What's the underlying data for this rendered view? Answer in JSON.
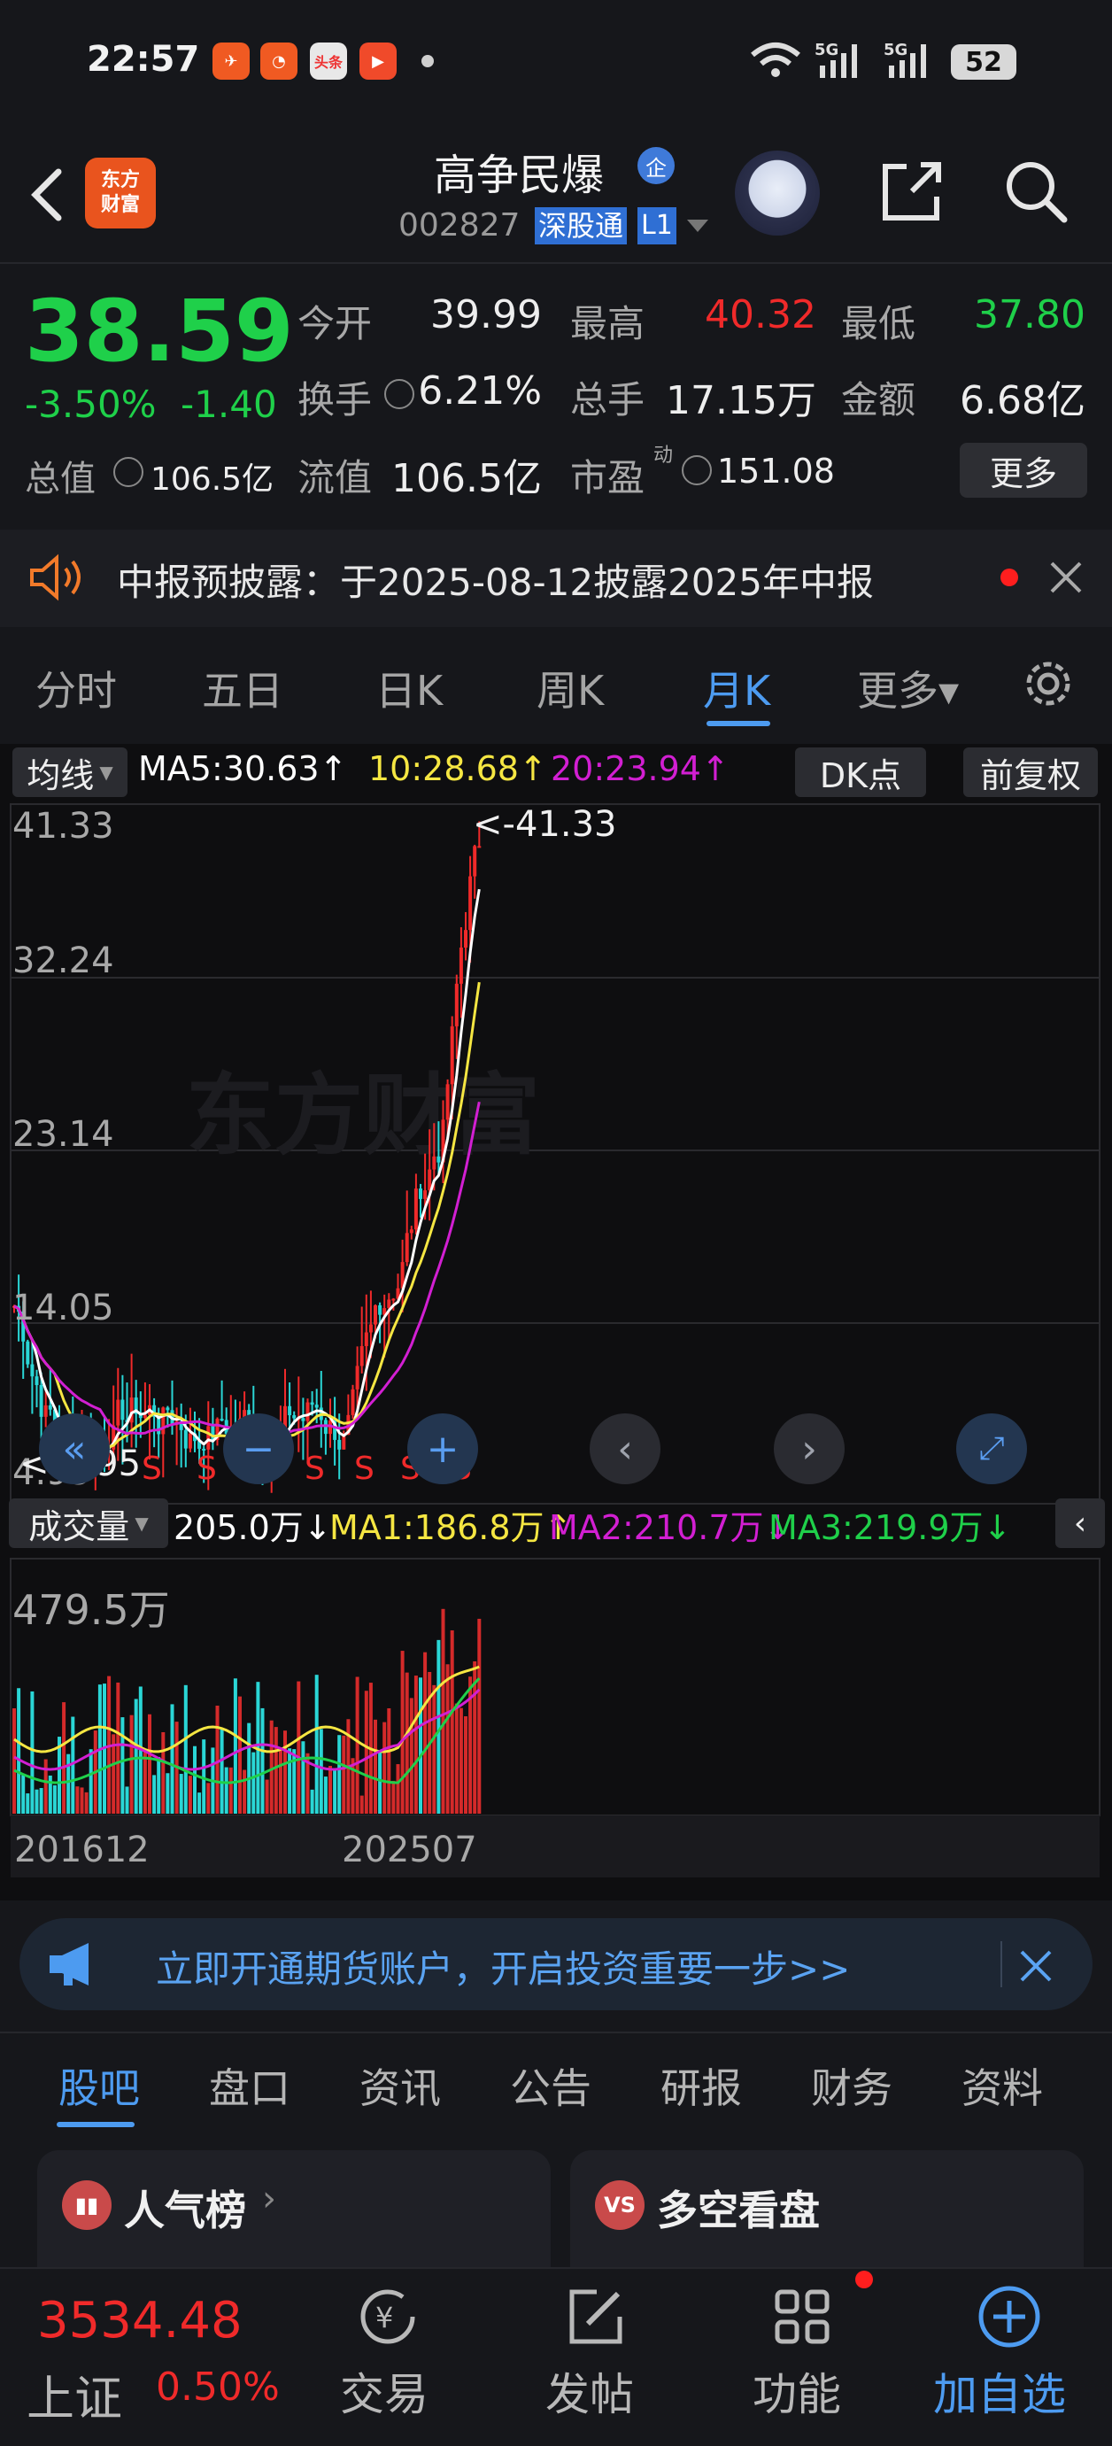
{
  "status_bar": {
    "time": "22:57",
    "battery": "52",
    "app_icons": [
      "feishu-icon",
      "app-icon",
      "toutiao-icon",
      "video-icon"
    ],
    "toutiao_label": "头条"
  },
  "header": {
    "logo_line1": "东方",
    "logo_line2": "财富",
    "stock_name": "高争民爆",
    "badge": "企",
    "code": "002827",
    "market_tag": "深股通",
    "level_tag": "L1"
  },
  "quote": {
    "price": "38.59",
    "change_pct": "-3.50%",
    "change": "-1.40",
    "open_label": "今开",
    "open": "39.99",
    "high_label": "最高",
    "high": "40.32",
    "low_label": "最低",
    "low": "37.80",
    "turnover_label": "换手",
    "turnover": "6.21%",
    "volume_label": "总手",
    "volume": "17.15万",
    "amount_label": "金额",
    "amount": "6.68亿",
    "mktcap_label": "总值",
    "mktcap": "106.5亿",
    "float_label": "流值",
    "float": "106.5亿",
    "pe_label": "市盈",
    "pe_sup": "动",
    "pe": "151.08",
    "more_label": "更多"
  },
  "notice": {
    "text": "中报预披露：于2025-08-12披露2025年中报"
  },
  "tabs": [
    {
      "label": "分时"
    },
    {
      "label": "五日"
    },
    {
      "label": "日K"
    },
    {
      "label": "周K"
    },
    {
      "label": "月K"
    },
    {
      "label": "更多▾"
    }
  ],
  "ma_bar": {
    "selector": "均线",
    "ma5": "MA5:30.63↑",
    "ma10": "10:28.68↑",
    "ma20": "20:23.94↑",
    "dk": "DK点",
    "adjust": "前复权"
  },
  "price_axis": {
    "top": "41.33",
    "mid1": "32.24",
    "mid2": "23.14",
    "mid3": "14.05",
    "bottom": "4.95",
    "max_marker": "<-41.33",
    "min_marker": "<-4.95"
  },
  "sell_markers": [
    "S",
    "S",
    "S",
    "S",
    "S",
    "S",
    "S",
    "S"
  ],
  "volume_bar": {
    "selector": "成交量",
    "vol": "205.0万↓",
    "ma1": "MA1:186.8万↑",
    "ma2": "MA2:210.7万↓",
    "ma3": "MA3:219.9万↓",
    "axis_top": "479.5万"
  },
  "x_axis": {
    "start": "201612",
    "end": "202507"
  },
  "banner": {
    "text": "立即开通期货账户，开启投资重要一步>>"
  },
  "sub_tabs": [
    {
      "label": "股吧"
    },
    {
      "label": "盘口"
    },
    {
      "label": "资讯"
    },
    {
      "label": "公告"
    },
    {
      "label": "研报"
    },
    {
      "label": "财务"
    },
    {
      "label": "资料"
    }
  ],
  "cards": {
    "left_title": "人气榜",
    "right_title": "多空看盘"
  },
  "bottom_nav": {
    "index_value": "3534.48",
    "index_name": "上证",
    "index_pct": "0.50%",
    "trade": "交易",
    "post": "发帖",
    "function": "功能",
    "add": "加自选"
  },
  "colors": {
    "up": "#f02a2a",
    "down": "#1fd04a",
    "accent": "#4d9bf0",
    "ma5": "#ffffff",
    "ma10": "#f5e642",
    "ma20": "#d21fd2"
  }
}
